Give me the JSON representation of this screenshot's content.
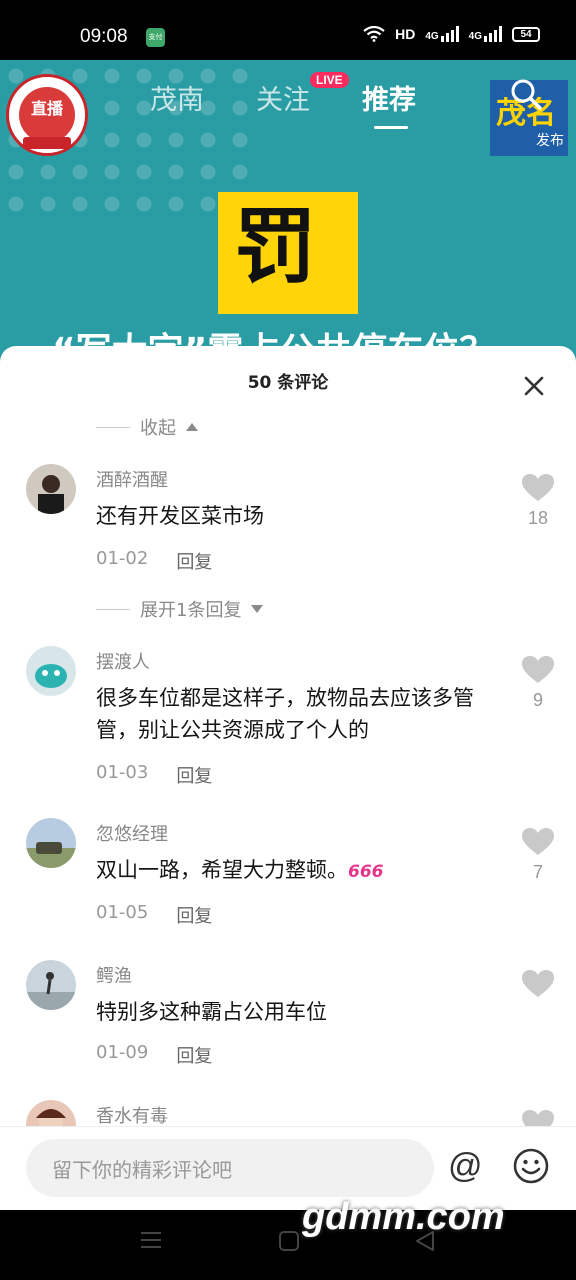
{
  "status_bar": {
    "time": "09:08",
    "app_icon_label": "支付",
    "network": "HD",
    "signal1": "4G",
    "signal2": "4G",
    "battery": "54"
  },
  "video": {
    "tabs": [
      {
        "label": "茂南",
        "active": false
      },
      {
        "label": "关注",
        "active": false
      },
      {
        "label": "推荐",
        "active": true
      }
    ],
    "live_badge": "LIVE",
    "channel_logo_text": "直播",
    "brand_badge": {
      "main": "茂名",
      "sub": "发布"
    },
    "sign_text": "罚",
    "caption": "“写大字”霸占公共停车位？"
  },
  "sheet": {
    "title": "50 条评论",
    "collapse_label": "收起",
    "expand_label": "展开1条回复",
    "comments": [
      {
        "name": "酒醉酒醒",
        "text": "还有开发区菜市场",
        "date": "01-02",
        "reply": "回复",
        "likes": "18"
      },
      {
        "name": "摆渡人",
        "text": "很多车位都是这样子，放物品去应该多管管，别让公共资源成了个人的",
        "date": "01-03",
        "reply": "回复",
        "likes": "9"
      },
      {
        "name": "忽悠经理",
        "text": "双山一路，希望大力整顿。",
        "emoji": "666",
        "date": "01-05",
        "reply": "回复",
        "likes": "7"
      },
      {
        "name": "鳄渔",
        "text": "特别多这种霸占公用车位",
        "date": "01-09",
        "reply": "回复",
        "likes": ""
      },
      {
        "name": "香水有毒",
        "text": "",
        "date": "",
        "reply": "",
        "likes": ""
      }
    ],
    "input_placeholder": "留下你的精彩评论吧",
    "at_symbol": "@"
  },
  "watermark": "gdmm.com",
  "colors": {
    "video_bg": "#2a9ca3",
    "live": "#ff2b5e",
    "sign": "#ffd50a"
  }
}
